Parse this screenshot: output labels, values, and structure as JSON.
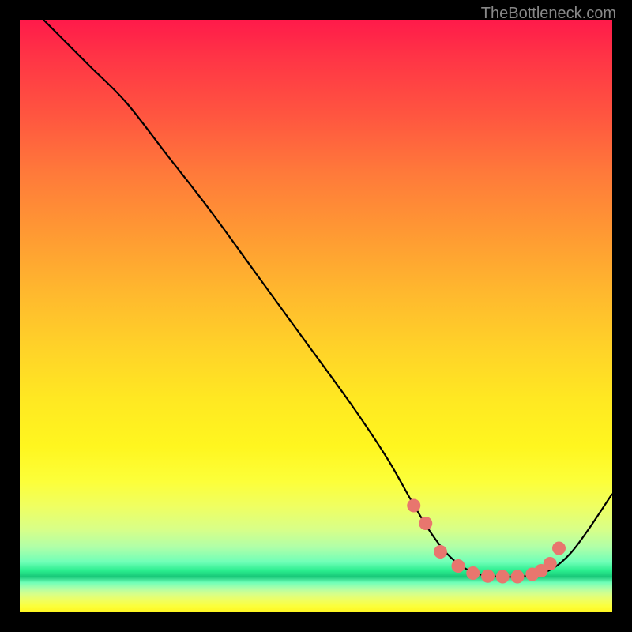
{
  "attribution": "TheBottleneck.com",
  "chart_data": {
    "type": "line",
    "title": "",
    "xlabel": "",
    "ylabel": "",
    "xlim": [
      0,
      100
    ],
    "ylim": [
      0,
      100
    ],
    "series": [
      {
        "name": "curve",
        "x": [
          4,
          8,
          12,
          18,
          25,
          32,
          40,
          48,
          56,
          62,
          66,
          69,
          72,
          75,
          78,
          81,
          84,
          87,
          90,
          93,
          96,
          100
        ],
        "y": [
          100,
          96,
          92,
          86,
          77,
          68,
          57,
          46,
          35,
          26,
          19,
          14,
          10,
          7.5,
          6.3,
          6.0,
          6.0,
          6.3,
          7.4,
          10,
          14,
          20
        ]
      }
    ],
    "markers": {
      "name": "highlight-points",
      "x": [
        66.5,
        68.5,
        71,
        74,
        76.5,
        79,
        81.5,
        84,
        86.5,
        88,
        89.5,
        91
      ],
      "y": [
        18,
        15,
        10.2,
        7.8,
        6.6,
        6.1,
        6.0,
        6.0,
        6.4,
        7.0,
        8.2,
        10.8
      ]
    },
    "background": {
      "type": "vertical-gradient",
      "stops": [
        {
          "pos": 0,
          "color": "#ff1a4a"
        },
        {
          "pos": 50,
          "color": "#ffd428"
        },
        {
          "pos": 80,
          "color": "#f0ff60"
        },
        {
          "pos": 93,
          "color": "#18c878"
        },
        {
          "pos": 100,
          "color": "#fff61f"
        }
      ]
    }
  }
}
